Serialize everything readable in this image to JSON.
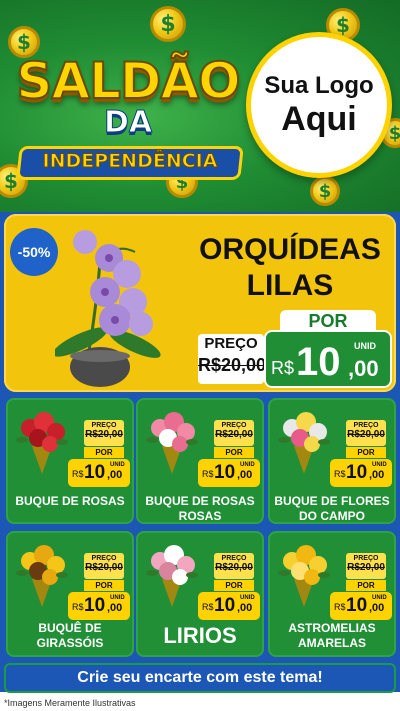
{
  "header": {
    "title_line1": "SALDÃO",
    "title_line2": "DA",
    "title_line3": "INDEPENDÊNCIA",
    "logo_line1": "Sua Logo",
    "logo_line2": "Aqui",
    "coin_symbol": "$"
  },
  "featured": {
    "discount": "-50%",
    "name_line1": "ORQUÍDEAS",
    "name_line2": "LILAS",
    "preco_label": "PREÇO",
    "old_price": "R$20,00",
    "por_label": "POR",
    "currency": "R$",
    "price_int": "10",
    "price_cents": ",00",
    "unid": "UNID"
  },
  "price_labels": {
    "preco": "PREÇO",
    "old": "R$20,00",
    "por": "POR",
    "currency": "R$",
    "int": "10",
    "cents": ",00",
    "unid": "UNID"
  },
  "products": [
    {
      "name": "BUQUE DE ROSAS"
    },
    {
      "name": "BUQUE DE ROSAS ROSAS"
    },
    {
      "name": "BUQUE DE FLORES DO CAMPO"
    },
    {
      "name": "BUQUÊ DE GIRASSÓIS"
    },
    {
      "name": "LIRIOS"
    },
    {
      "name": "ASTROMELIAS AMARELAS"
    }
  ],
  "footer": {
    "cta": "Crie seu encarte com este tema!",
    "disclaimer": "*Imagens Meramente Ilustrativas"
  },
  "colors": {
    "green": "#1f8c33",
    "yellow": "#ffd200",
    "blue": "#1c57b5"
  }
}
